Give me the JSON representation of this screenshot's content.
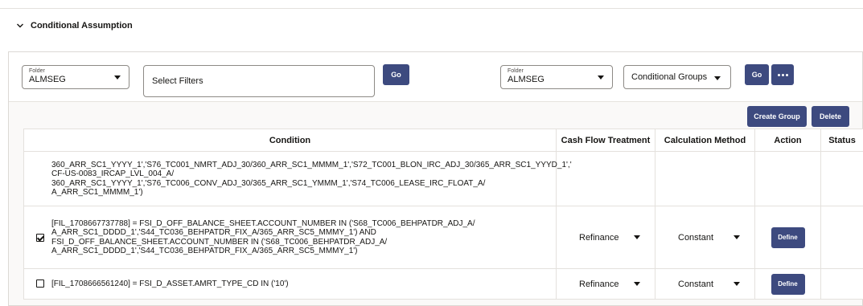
{
  "section": {
    "title": "Conditional Assumption"
  },
  "filters": {
    "left_folder": {
      "caption": "Folder",
      "value": "ALMSEG"
    },
    "filter_placeholder": "Select Filters",
    "left_go": "Go",
    "right_folder": {
      "caption": "Folder",
      "value": "ALMSEG"
    },
    "groups_value": "Conditional Groups",
    "right_go": "Go"
  },
  "actions": {
    "create_group": "Create Group",
    "delete": "Delete"
  },
  "table": {
    "headers": {
      "condition": "Condition",
      "cash_flow": "Cash Flow Treatment",
      "calc_method": "Calculation Method",
      "action": "Action",
      "status": "Status"
    },
    "rows": [
      {
        "lines": [
          "360_ARR_SC1_YYYY_1','S76_TC001_NMRT_ADJ_30/360_ARR_SC1_MMMM_1','S72_TC001_BLON_IRC_ADJ_30/365_ARR_SC1_YYYD_1','",
          "CF-US-0083_IRCAP_LVL_004_A/",
          "360_ARR_SC1_YYYY_1','S76_TC006_CONV_ADJ_30/365_ARR_SC1_YMMM_1','S74_TC006_LEASE_IRC_FLOAT_A/",
          "A_ARR_SC1_MMMM_1')"
        ]
      },
      {
        "checked": true,
        "lines": [
          "[FIL_1708667737788] = FSI_D_OFF_BALANCE_SHEET.ACCOUNT_NUMBER IN ('S68_TC006_BEHPATDR_ADJ_A/",
          "A_ARR_SC1_DDDD_1','S44_TC036_BEHPATDR_FIX_A/365_ARR_SC5_MMMY_1') AND",
          "FSI_D_OFF_BALANCE_SHEET.ACCOUNT_NUMBER IN ('S68_TC006_BEHPATDR_ADJ_A/",
          "A_ARR_SC1_DDDD_1','S44_TC036_BEHPATDR_FIX_A/365_ARR_SC5_MMMY_1')"
        ],
        "cash_flow": "Refinance",
        "calc_method": "Constant",
        "action": "Define"
      },
      {
        "checked": false,
        "lines": [
          "[FIL_1708666561240] = FSI_D_ASSET.AMRT_TYPE_CD IN ('10')"
        ],
        "cash_flow": "Refinance",
        "calc_method": "Constant",
        "action": "Define"
      }
    ]
  }
}
